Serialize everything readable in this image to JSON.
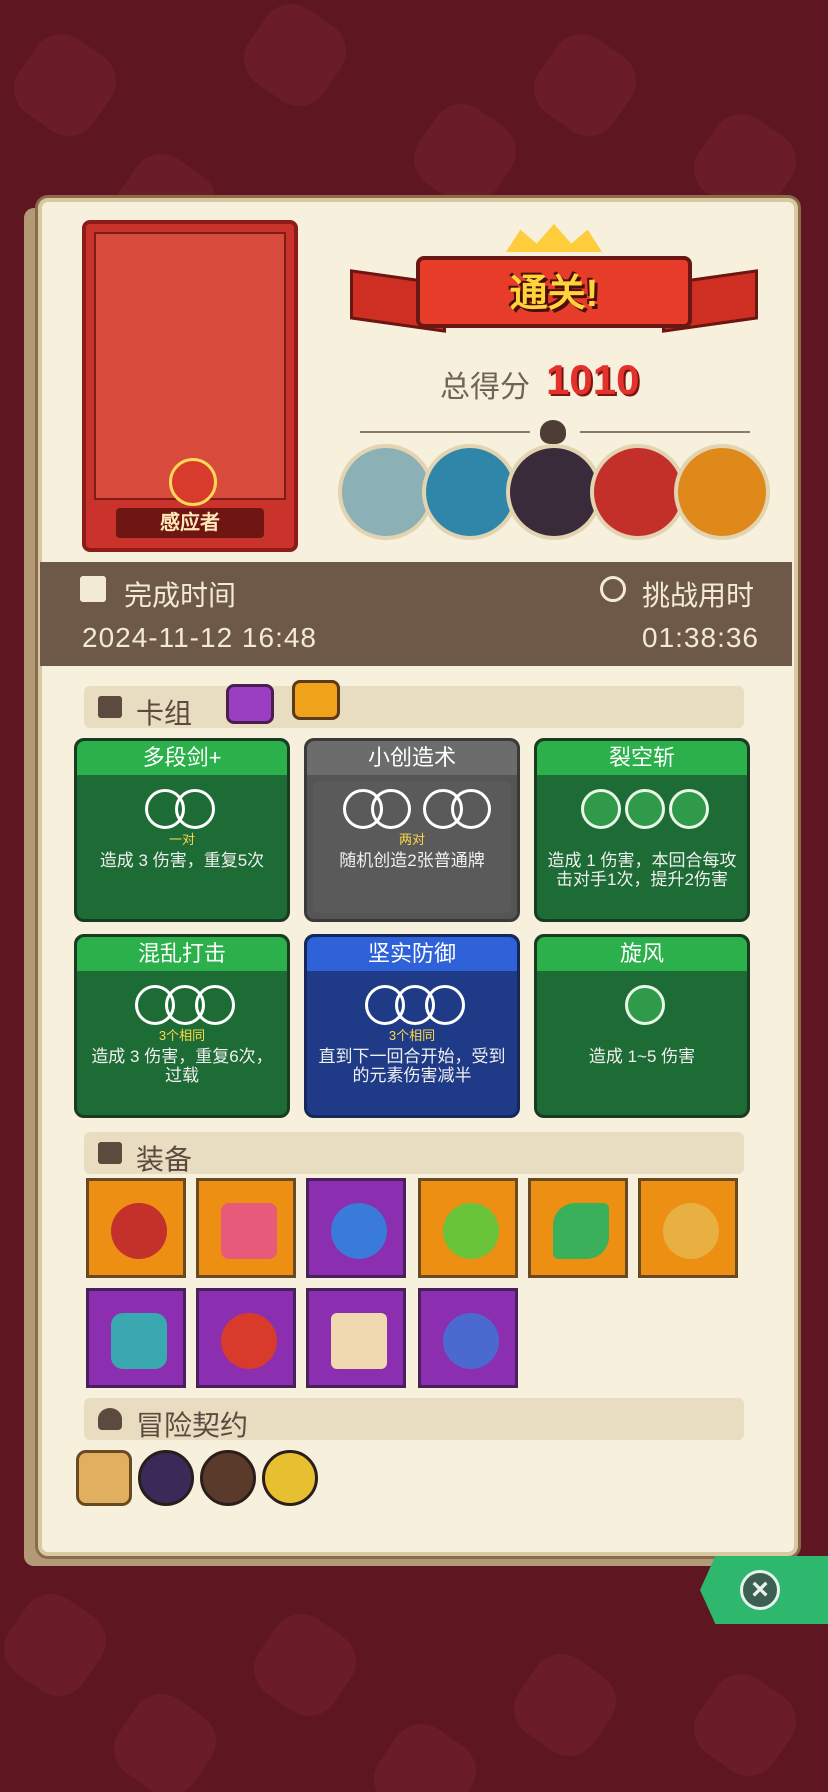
{
  "result": {
    "title": "通关!",
    "score_label": "总得分",
    "score_value": "1010"
  },
  "hero": {
    "name": "感应者"
  },
  "time": {
    "finish_label": "完成时间",
    "finish_value": "2024-11-12 16:48",
    "challenge_label": "挑战用时",
    "challenge_value": "01:38:36"
  },
  "sections": {
    "deck": "卡组",
    "equipment": "装备",
    "contract": "冒险契约"
  },
  "cards": [
    {
      "title": "多段剑+",
      "cap": "一对",
      "desc": "造成 3 伤害，重复5次"
    },
    {
      "title": "小创造术",
      "cap": "两对",
      "desc": "随机创造2张普通牌"
    },
    {
      "title": "裂空斩",
      "cap": "",
      "desc": "造成 1 伤害，本回合每攻击对手1次，提升2伤害"
    },
    {
      "title": "混乱打击",
      "cap": "3个相同",
      "desc": "造成 3 伤害，重复6次，过载"
    },
    {
      "title": "坚实防御",
      "cap": "3个相同",
      "desc": "直到下一回合开始，受到的元素伤害减半"
    },
    {
      "title": "旋风",
      "cap": "",
      "desc": "造成 1~5 伤害"
    }
  ],
  "colors": {
    "background": "#5e1720",
    "panel": "#f6f0dd",
    "accent_red": "#e3312b",
    "card_green": "#1d6b35",
    "card_blue": "#1f3b87",
    "card_gray": "#555555"
  }
}
